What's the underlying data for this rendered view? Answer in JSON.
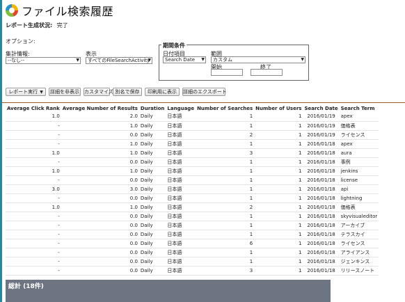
{
  "page": {
    "title": "ファイル検索履歴",
    "status_label": "レポート生成状況:",
    "status_value": "完了",
    "options_label": "オプション:"
  },
  "filters": {
    "summary_label": "集計情報:",
    "summary_value": "--なし--",
    "display_label": "表示",
    "display_value": "すべてのFileSearchActivity",
    "period_title": "期間条件",
    "date_field_label": "日付項目",
    "date_field_value": "Search Date",
    "range_label": "範囲",
    "range_value": "カスタム",
    "start_label": "開始",
    "end_label": "終了"
  },
  "toolbar": {
    "run_report": "レポート実行",
    "hide_details": "詳細を非表示",
    "customize": "カスタマイズ",
    "save_as": "別名で保存",
    "printable_view": "印刷用に表示",
    "export_details": "詳細のエクスポート"
  },
  "table": {
    "headers": [
      "Average Click Rank",
      "Average Number of Results",
      "Duration",
      "Language",
      "Number of Searches",
      "Number of Users",
      "Search Date",
      "Search Term"
    ],
    "rows": [
      [
        "1.0",
        "2.0",
        "Daily",
        "日本語",
        "1",
        "1",
        "2016/01/19",
        "apex"
      ],
      [
        "-",
        "1.0",
        "Daily",
        "日本語",
        "1",
        "1",
        "2016/01/19",
        "価格表"
      ],
      [
        "-",
        "0.0",
        "Daily",
        "日本語",
        "2",
        "1",
        "2016/01/19",
        "ライセンス"
      ],
      [
        "-",
        "1.0",
        "Daily",
        "日本語",
        "1",
        "1",
        "2016/01/18",
        "apex"
      ],
      [
        "1.0",
        "1.0",
        "Daily",
        "日本語",
        "3",
        "1",
        "2016/01/18",
        "aura"
      ],
      [
        "-",
        "0.0",
        "Daily",
        "日本語",
        "1",
        "1",
        "2016/01/18",
        "事例"
      ],
      [
        "1.0",
        "1.0",
        "Daily",
        "日本語",
        "1",
        "1",
        "2016/01/18",
        "jenkins"
      ],
      [
        "-",
        "0.0",
        "Daily",
        "日本語",
        "1",
        "1",
        "2016/01/18",
        "license"
      ],
      [
        "3.0",
        "3.0",
        "Daily",
        "日本語",
        "1",
        "1",
        "2016/01/18",
        "api"
      ],
      [
        "-",
        "0.0",
        "Daily",
        "日本語",
        "1",
        "1",
        "2016/01/18",
        "lightning"
      ],
      [
        "1.0",
        "1.0",
        "Daily",
        "日本語",
        "2",
        "1",
        "2016/01/18",
        "価格表"
      ],
      [
        "-",
        "0.0",
        "Daily",
        "日本語",
        "1",
        "1",
        "2016/01/18",
        "skyvisualeditor"
      ],
      [
        "-",
        "0.0",
        "Daily",
        "日本語",
        "1",
        "1",
        "2016/01/18",
        "アーカイブ"
      ],
      [
        "-",
        "0.0",
        "Daily",
        "日本語",
        "1",
        "1",
        "2016/01/18",
        "テラスカイ"
      ],
      [
        "-",
        "0.0",
        "Daily",
        "日本語",
        "6",
        "1",
        "2016/01/18",
        "ライセンス"
      ],
      [
        "-",
        "0.0",
        "Daily",
        "日本語",
        "1",
        "1",
        "2016/01/18",
        "アライアンス"
      ],
      [
        "-",
        "0.0",
        "Daily",
        "日本語",
        "1",
        "1",
        "2016/01/18",
        "ジェンキンス"
      ],
      [
        "-",
        "0.0",
        "Daily",
        "日本語",
        "3",
        "1",
        "2016/01/18",
        "リリースノート"
      ]
    ]
  },
  "total": {
    "label": "総計 (18件)"
  },
  "colors": {
    "accent_bar": "#1e88a8",
    "divider": "#9b5a2a",
    "total_bar": "#6d7582"
  }
}
